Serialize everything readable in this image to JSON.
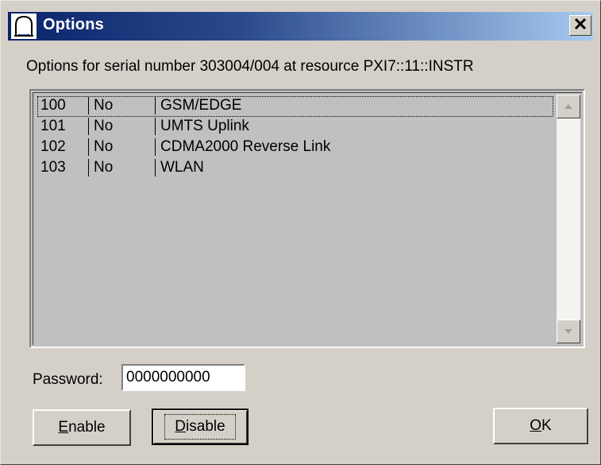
{
  "window": {
    "title": "Options",
    "close_glyph": "✕"
  },
  "info": {
    "text": "Options for serial number 303004/004 at resource PXI7::11::INSTR"
  },
  "options_list": {
    "rows": [
      {
        "number": "100",
        "enabled": "No",
        "name": "GSM/EDGE"
      },
      {
        "number": "101",
        "enabled": "No",
        "name": "UMTS Uplink"
      },
      {
        "number": "102",
        "enabled": "No",
        "name": "CDMA2000 Reverse Link"
      },
      {
        "number": "103",
        "enabled": "No",
        "name": "WLAN"
      }
    ],
    "focused_row": 0
  },
  "password": {
    "label": "Password:",
    "value": "0000000000"
  },
  "buttons": {
    "enable": {
      "mnemonic": "E",
      "rest": "nable"
    },
    "disable": {
      "mnemonic": "D",
      "rest": "isable"
    },
    "ok": {
      "mnemonic": "O",
      "rest": "K"
    }
  },
  "colors": {
    "title_gradient_start": "#0a246a",
    "title_gradient_end": "#a6caf0",
    "dialog_face": "#d4d0c8"
  },
  "icons": {
    "title": "app-bell-icon",
    "close": "close-icon",
    "scroll_up": "arrow-up-icon",
    "scroll_down": "arrow-down-icon"
  }
}
